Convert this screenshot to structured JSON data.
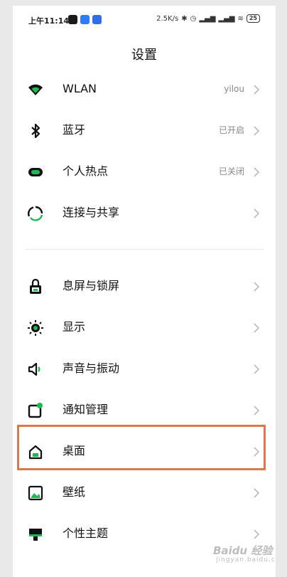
{
  "status_bar": {
    "time": "上午11:14",
    "net_speed": "2.5K/s",
    "battery": "25",
    "apps": [
      {
        "icon": "tiktok-icon",
        "color": "#1a1a1a"
      },
      {
        "icon": "video-app-icon",
        "color": "#2e7cf6"
      },
      {
        "icon": "app-icon",
        "color": "#2f6ee8"
      }
    ],
    "indicators": [
      "bluetooth-icon",
      "alarm-icon",
      "signal-icon",
      "signal-icon",
      "wifi-icon"
    ]
  },
  "page": {
    "title": "设置",
    "accent_color": "#1fb954",
    "highlight_color": "#d97a4a"
  },
  "settings": {
    "wlan": {
      "label": "WLAN",
      "value": "yilou",
      "icon": "wifi-icon"
    },
    "bluetooth": {
      "label": "蓝牙",
      "value": "已开启",
      "icon": "bluetooth-icon"
    },
    "hotspot": {
      "label": "个人热点",
      "value": "已关闭",
      "icon": "hotspot-icon"
    },
    "connection": {
      "label": "连接与共享",
      "icon": "share-icon"
    },
    "lockscreen": {
      "label": "息屏与锁屏",
      "icon": "lock-icon"
    },
    "display": {
      "label": "显示",
      "icon": "sun-icon"
    },
    "sound": {
      "label": "声音与振动",
      "icon": "speaker-icon"
    },
    "notifications": {
      "label": "通知管理",
      "icon": "notification-icon"
    },
    "desktop": {
      "label": "桌面",
      "icon": "home-icon"
    },
    "wallpaper": {
      "label": "壁纸",
      "icon": "image-icon"
    },
    "theme": {
      "label": "个性主题",
      "icon": "theme-icon"
    }
  },
  "watermark": {
    "brand": "Baidu 经验",
    "sub": "jingyan.baidu.com"
  }
}
